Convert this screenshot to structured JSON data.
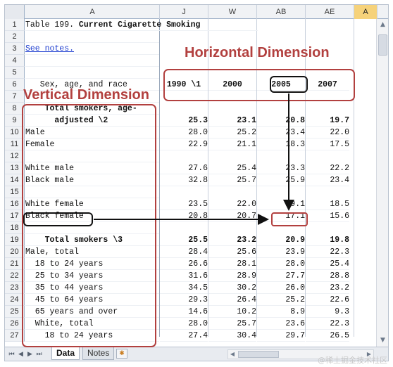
{
  "columns": [
    "A",
    "J",
    "W",
    "AB",
    "AE",
    "A"
  ],
  "rows": [
    {
      "n": "1",
      "a": "Table 199. ",
      "a_bold": "Current Cigarette Smoking",
      "type": "title"
    },
    {
      "n": "2",
      "a": "",
      "type": "blank"
    },
    {
      "n": "3",
      "a": "See notes.",
      "type": "link"
    },
    {
      "n": "4",
      "a": "",
      "type": "blank"
    },
    {
      "n": "5",
      "a": "",
      "type": "blank"
    },
    {
      "n": "6",
      "a": "   Sex, age, and race",
      "j": "1990 \\1",
      "w": "2000",
      "ab": "2005",
      "ae": "2007",
      "type": "header"
    },
    {
      "n": "7",
      "a": "",
      "type": "blank"
    },
    {
      "n": "8",
      "a": "    Total smokers, age-",
      "type": "boldlabel"
    },
    {
      "n": "9",
      "a": "      adjusted \\2",
      "j": "25.3",
      "w": "23.1",
      "ab": "20.8",
      "ae": "19.7",
      "type": "boldrow"
    },
    {
      "n": "10",
      "a": "Male",
      "j": "28.0",
      "w": "25.2",
      "ab": "23.4",
      "ae": "22.0",
      "type": "data"
    },
    {
      "n": "11",
      "a": "Female",
      "j": "22.9",
      "w": "21.1",
      "ab": "18.3",
      "ae": "17.5",
      "type": "data"
    },
    {
      "n": "12",
      "a": "",
      "type": "blank"
    },
    {
      "n": "13",
      "a": "White male",
      "j": "27.6",
      "w": "25.4",
      "ab": "23.3",
      "ae": "22.2",
      "type": "data"
    },
    {
      "n": "14",
      "a": "Black male",
      "j": "32.8",
      "w": "25.7",
      "ab": "25.9",
      "ae": "23.4",
      "type": "data"
    },
    {
      "n": "15",
      "a": "",
      "type": "blank"
    },
    {
      "n": "16",
      "a": "White female",
      "j": "23.5",
      "w": "22.0",
      "ab": "19.1",
      "ae": "18.5",
      "type": "data"
    },
    {
      "n": "17",
      "a": "Black female",
      "j": "20.8",
      "w": "20.7",
      "ab": "17.1",
      "ae": "15.6",
      "type": "data"
    },
    {
      "n": "18",
      "a": "",
      "type": "blank"
    },
    {
      "n": "19",
      "a": "    Total smokers \\3",
      "j": "25.5",
      "w": "23.2",
      "ab": "20.9",
      "ae": "19.8",
      "type": "boldrow"
    },
    {
      "n": "20",
      "a": "Male, total",
      "j": "28.4",
      "w": "25.6",
      "ab": "23.9",
      "ae": "22.3",
      "type": "data"
    },
    {
      "n": "21",
      "a": "  18 to 24 years",
      "j": "26.6",
      "w": "28.1",
      "ab": "28.0",
      "ae": "25.4",
      "type": "data"
    },
    {
      "n": "22",
      "a": "  25 to 34 years",
      "j": "31.6",
      "w": "28.9",
      "ab": "27.7",
      "ae": "28.8",
      "type": "data"
    },
    {
      "n": "23",
      "a": "  35 to 44 years",
      "j": "34.5",
      "w": "30.2",
      "ab": "26.0",
      "ae": "23.2",
      "type": "data"
    },
    {
      "n": "24",
      "a": "  45 to 64 years",
      "j": "29.3",
      "w": "26.4",
      "ab": "25.2",
      "ae": "22.6",
      "type": "data"
    },
    {
      "n": "25",
      "a": "  65 years and over",
      "j": "14.6",
      "w": "10.2",
      "ab": "8.9",
      "ae": "9.3",
      "type": "data"
    },
    {
      "n": "26",
      "a": "  White, total",
      "j": "28.0",
      "w": "25.7",
      "ab": "23.6",
      "ae": "22.3",
      "type": "data"
    },
    {
      "n": "27",
      "a": "    18 to 24 years",
      "j": "27.4",
      "w": "30.4",
      "ab": "29.7",
      "ae": "26.5",
      "type": "data"
    }
  ],
  "annotations": {
    "horizontal": "Horizontal Dimension",
    "vertical": "Vertical Dimension"
  },
  "tabs": [
    "Data",
    "Notes"
  ],
  "watermark": "@稀土掘金技术社区",
  "colors": {
    "annotation": "#b2403f",
    "highlight": "#111111",
    "active_col": "#f6d27a"
  }
}
